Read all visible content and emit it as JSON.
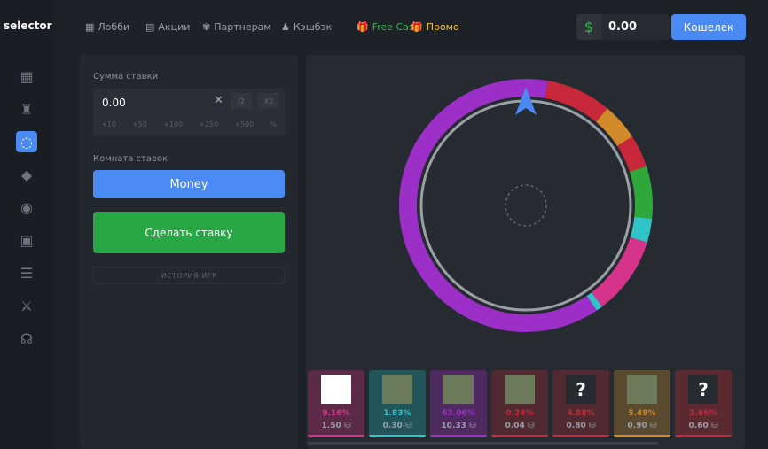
{
  "logo": "selector",
  "sidebar": [
    "slots-icon",
    "castle-icon",
    "wheel-icon",
    "cube-icon",
    "circle-icon",
    "game-icon",
    "coins-icon",
    "swords-icon",
    "headset-icon"
  ],
  "nav": [
    {
      "icon": "▦",
      "label": "Лобби",
      "color": "#9aa0aa"
    },
    {
      "icon": "▤",
      "label": "Акции",
      "color": "#9aa0aa"
    },
    {
      "icon": "✾",
      "label": "Партнерам",
      "color": "#9aa0aa"
    },
    {
      "icon": "♟",
      "label": "Кэшбэк",
      "color": "#9aa0aa"
    },
    {
      "icon": "🎁",
      "label": "Free Cash",
      "color": "#3cb34a"
    },
    {
      "icon": "🎁",
      "label": "Промо",
      "color": "#f5c518"
    }
  ],
  "balance": "0.00",
  "wallet": "Кошелек",
  "panel": {
    "amount_label": "Сумма ставки",
    "amount": "0.00",
    "half": "/2",
    "double": "X2",
    "quick": [
      "+10",
      "+50",
      "+100",
      "+250",
      "+500",
      "%"
    ],
    "room_label": "Комната ставок",
    "room": "Money",
    "bet": "Сделать ставку",
    "history": "ИСТОРИЯ ИГР"
  },
  "players": [
    {
      "pct": "9.16%",
      "amount": "1.50",
      "color": "#d6338a",
      "bg": "#5a2a48",
      "avatar": "text"
    },
    {
      "pct": "1.83%",
      "amount": "0.30",
      "color": "#2ec4c8",
      "bg": "#22555a",
      "avatar": "photo"
    },
    {
      "pct": "63.06%",
      "amount": "10.33",
      "color": "#9b2fc8",
      "bg": "#4f2a60",
      "avatar": "photo"
    },
    {
      "pct": "0.24%",
      "amount": "0.04",
      "color": "#c8283a",
      "bg": "#502a30",
      "avatar": "photo"
    },
    {
      "pct": "4.88%",
      "amount": "0.80",
      "color": "#c8283a",
      "bg": "#502a30",
      "avatar": "?"
    },
    {
      "pct": "5.49%",
      "amount": "0.90",
      "color": "#d08a2a",
      "bg": "#5a4a30",
      "avatar": "photo"
    },
    {
      "pct": "3.66%",
      "amount": "0.60",
      "color": "#c8283a",
      "bg": "#5a2a30",
      "avatar": "?"
    }
  ]
}
